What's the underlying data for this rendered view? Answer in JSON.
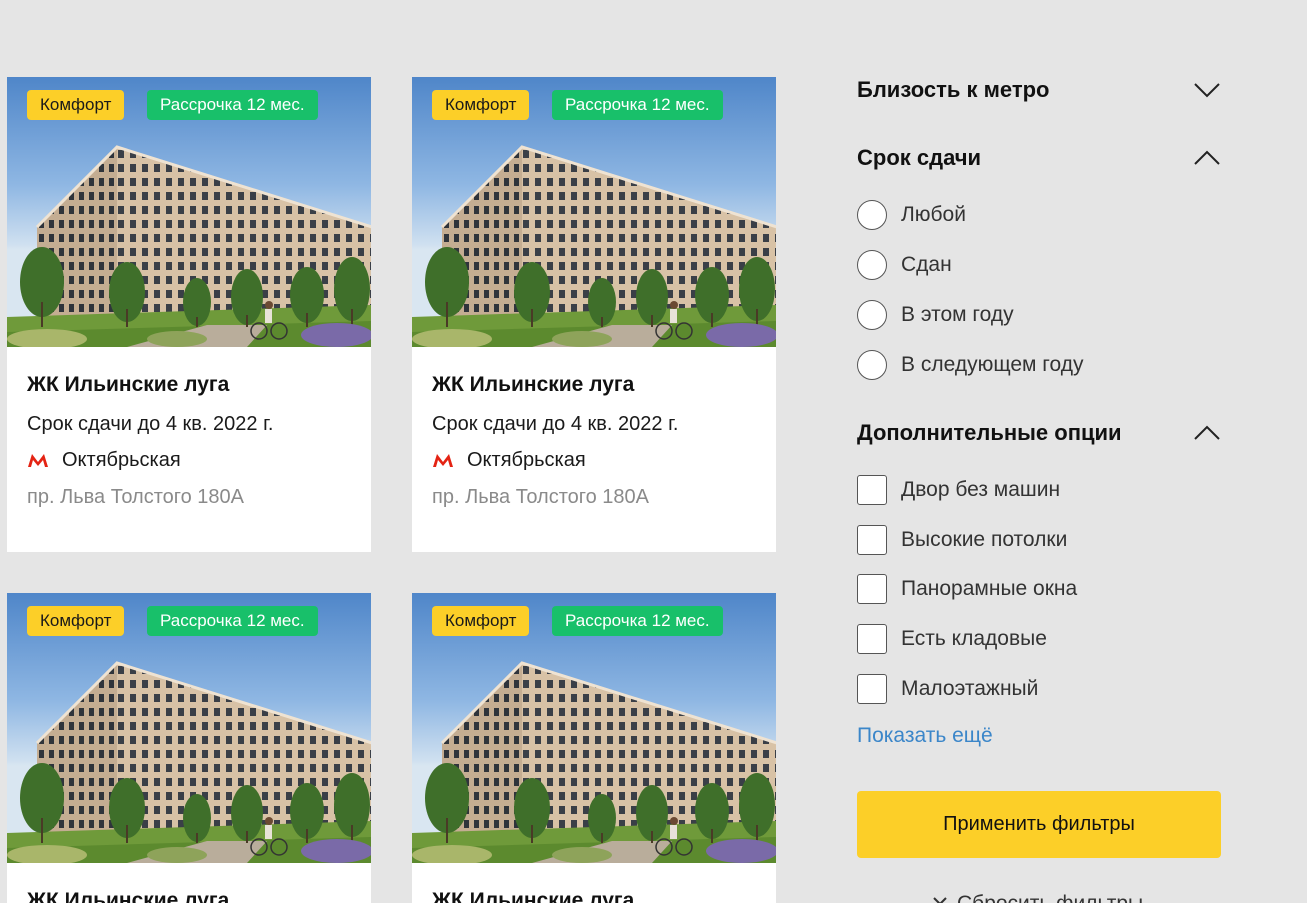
{
  "cards": [
    {
      "badge_comfort": "Комфорт",
      "badge_installment": "Рассрочка 12 мес.",
      "title": "ЖК Ильинские луга",
      "term": "Срок сдачи до 4 кв. 2022 г.",
      "metro": "Октябрьская",
      "address": "пр. Льва Толстого 180А"
    },
    {
      "badge_comfort": "Комфорт",
      "badge_installment": "Рассрочка 12 мес.",
      "title": "ЖК Ильинские луга",
      "term": "Срок сдачи до 4 кв. 2022 г.",
      "metro": "Октябрьская",
      "address": "пр. Льва Толстого 180А"
    },
    {
      "badge_comfort": "Комфорт",
      "badge_installment": "Рассрочка 12 мес.",
      "title": "ЖК Ильинские луга",
      "term": "",
      "metro": "",
      "address": ""
    },
    {
      "badge_comfort": "Комфорт",
      "badge_installment": "Рассрочка 12 мес.",
      "title": "ЖК Ильинские луга",
      "term": "",
      "metro": "",
      "address": ""
    }
  ],
  "filters": {
    "metro": {
      "title": "Близость к метро",
      "expanded": false
    },
    "deadline": {
      "title": "Срок сдачи",
      "expanded": true,
      "options": [
        "Любой",
        "Сдан",
        "В этом году",
        "В следующем году"
      ]
    },
    "extra": {
      "title": "Дополнительные опции",
      "expanded": true,
      "options": [
        "Двор без машин",
        "Высокие потолки",
        "Панорамные окна",
        "Есть кладовые",
        "Малоэтажный"
      ]
    },
    "show_more": "Показать ещё",
    "apply": "Применить фильтры",
    "reset": "Сбросить фильтры"
  },
  "colors": {
    "background": "#e5e5e5",
    "badge_comfort": "#fccf28",
    "badge_installment": "#18c06a",
    "metro": "#e42313",
    "link": "#3b86c9",
    "apply_button": "#fccf28"
  },
  "icons": {
    "metro": "metro-m-icon",
    "collapsed": "chevron-down-icon",
    "expanded": "chevron-up-icon",
    "reset": "close-icon"
  }
}
